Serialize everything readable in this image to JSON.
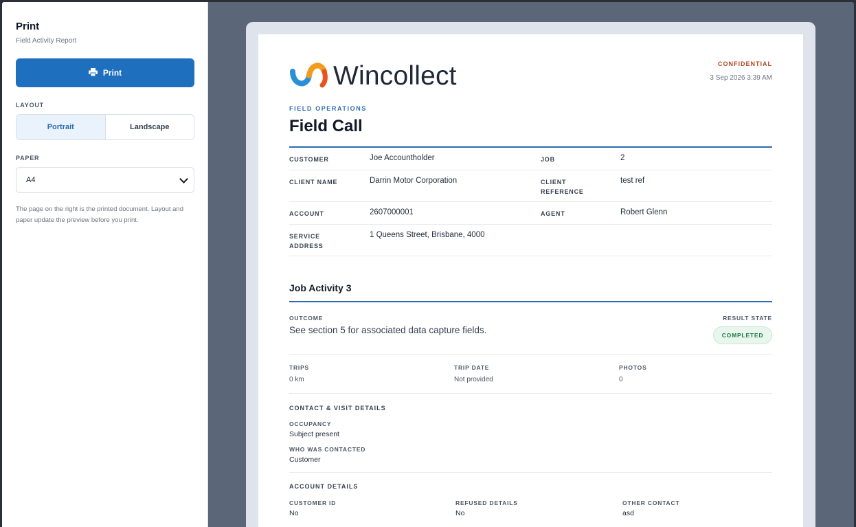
{
  "sidebar": {
    "title": "Print",
    "subtitle": "Field Activity Report",
    "print_label": "Print",
    "layout_label": "LAYOUT",
    "layout_options": [
      "Portrait",
      "Landscape"
    ],
    "layout_selected": "Portrait",
    "paper_label": "PAPER",
    "paper_value": "A4",
    "help_text": "The page on the right is the printed document. Layout and paper update the preview before you print."
  },
  "document": {
    "brand": "Wincollect",
    "confidential": "CONFIDENTIAL",
    "timestamp": "3 Sep 2026 3:39 AM",
    "eyebrow": "FIELD OPERATIONS",
    "title": "Field Call",
    "fields": {
      "customer_label": "CUSTOMER",
      "customer_value": "Joe Accountholder",
      "job_label": "JOB",
      "job_value": "2",
      "client_name_label": "CLIENT NAME",
      "client_name_value": "Darrin Motor Corporation",
      "client_reference_label_1": "CLIENT",
      "client_reference_label_2": "REFERENCE",
      "client_reference_value": "test ref",
      "account_label": "ACCOUNT",
      "account_value": "2607000001",
      "agent_label": "AGENT",
      "agent_value": "Robert Glenn",
      "service_address_label_1": "SERVICE",
      "service_address_label_2": "ADDRESS",
      "service_address_value": "1 Queens Street, Brisbane, 4000"
    },
    "activity": {
      "title": "Job Activity 3",
      "outcome_label": "OUTCOME",
      "outcome_value": "See section 5 for associated data capture fields.",
      "result_state_label": "RESULT STATE",
      "result_state_value": "COMPLETED",
      "trips_label": "TRIPS",
      "trips_value": "0 km",
      "trip_date_label": "TRIP DATE",
      "trip_date_value": "Not provided",
      "photos_label": "PHOTOS",
      "photos_value": "0",
      "contact_heading": "CONTACT & VISIT DETAILS",
      "occupancy_label": "OCCUPANCY",
      "occupancy_value": "Subject present",
      "who_contacted_label": "WHO WAS CONTACTED",
      "who_contacted_value": "Customer",
      "account_heading": "ACCOUNT DETAILS",
      "customer_id_label": "CUSTOMER ID",
      "customer_id_value": "No",
      "refused_label": "REFUSED DETAILS",
      "refused_value": "No",
      "other_contact_label": "OTHER CONTACT",
      "other_contact_value": "asd"
    }
  },
  "colors": {
    "accent": "#1f6fbf",
    "confidential": "#b7431d",
    "badge_text": "#1e7a43",
    "backdrop": "#5b6779"
  }
}
